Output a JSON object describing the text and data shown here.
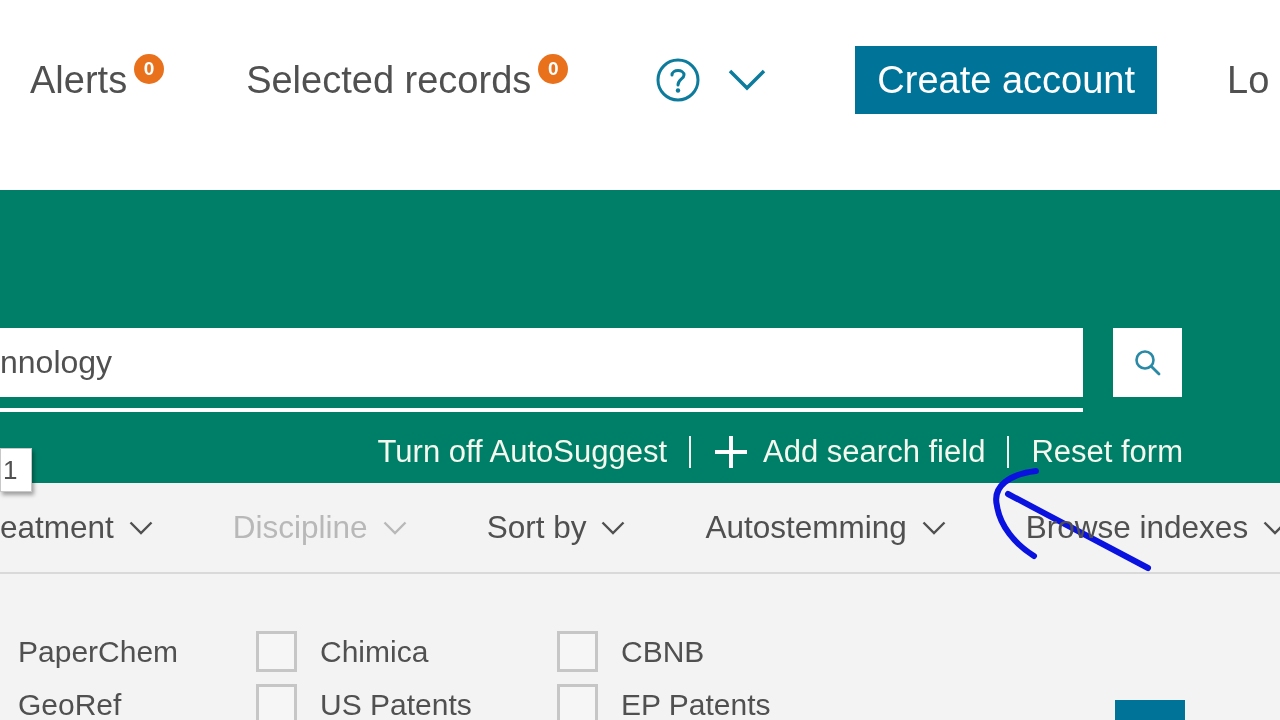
{
  "header": {
    "links": [
      {
        "label": "Alerts",
        "badge": "0"
      },
      {
        "label": "Selected records",
        "badge": "0"
      }
    ],
    "create_account_button": "Create account",
    "cut_link": "Lo"
  },
  "search": {
    "value": "nnology",
    "number_box": "1",
    "links": [
      {
        "label": "Turn off AutoSuggest",
        "kind": "plain"
      },
      {
        "label": "Add search field",
        "kind": "add"
      },
      {
        "label": "Reset form",
        "kind": "plain"
      }
    ]
  },
  "filters": [
    {
      "label": "eatment",
      "disabled": false
    },
    {
      "label": "Discipline",
      "disabled": true
    },
    {
      "label": "Sort by",
      "disabled": false
    },
    {
      "label": "Autostemming",
      "disabled": false
    },
    {
      "label": "Browse indexes",
      "disabled": false
    }
  ],
  "databases": {
    "columns": [
      {
        "items": [
          {
            "label": "PaperChem"
          },
          {
            "label": "GeoRef"
          }
        ]
      },
      {
        "items": [
          {
            "label": "Chimica",
            "checked": false
          },
          {
            "label": "US Patents",
            "checked": false
          }
        ]
      },
      {
        "items": [
          {
            "label": "CBNB",
            "checked": false
          },
          {
            "label": "EP Patents",
            "checked": false
          }
        ]
      }
    ]
  }
}
